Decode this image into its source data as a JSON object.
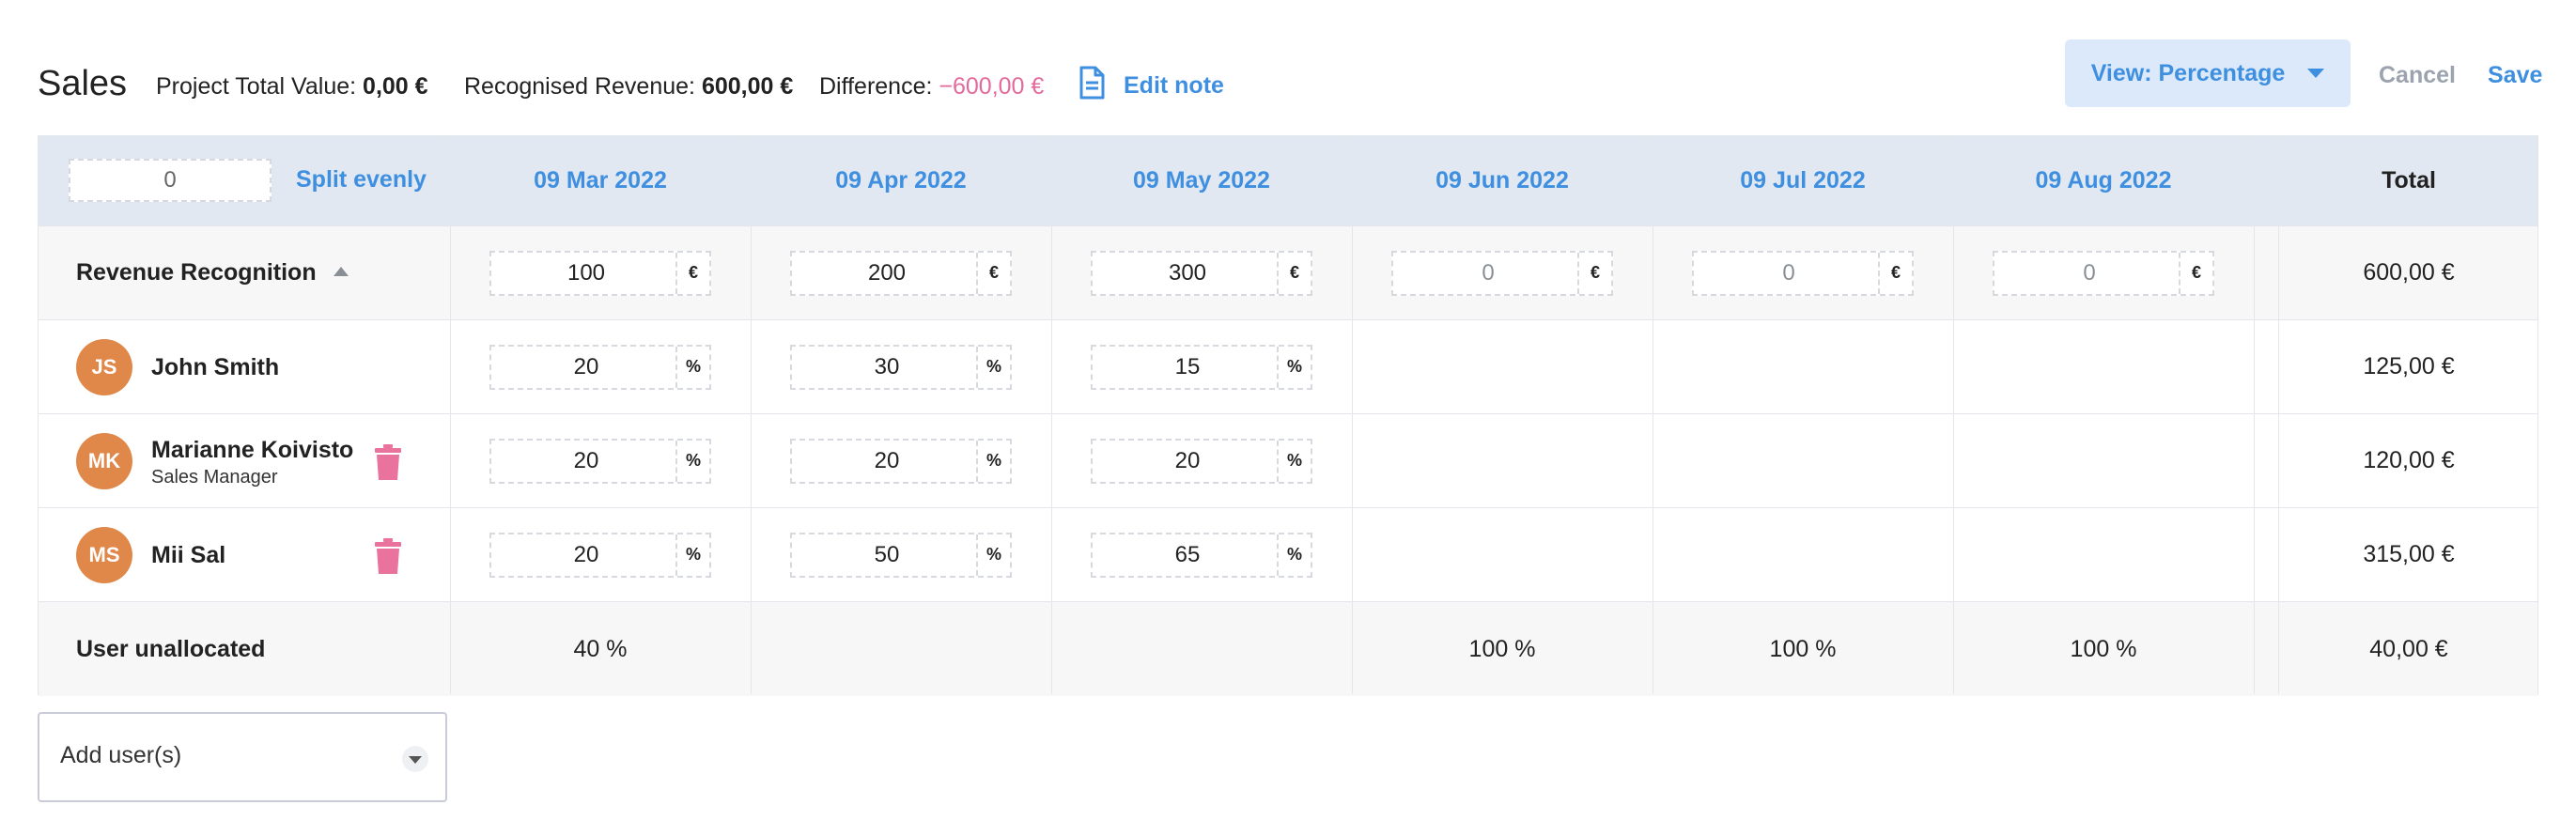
{
  "header": {
    "title": "Sales",
    "project_total_label": "Project Total Value:",
    "project_total_value": "0,00 €",
    "recognised_label": "Recognised Revenue:",
    "recognised_value": "600,00 €",
    "difference_label": "Difference:",
    "difference_value": "−600,00 €",
    "edit_note": "Edit note",
    "view_button": "View: Percentage",
    "cancel": "Cancel",
    "save": "Save"
  },
  "toolbar": {
    "split_input_value": "0",
    "split_evenly": "Split evenly"
  },
  "columns": [
    "09 Mar 2022",
    "09 Apr 2022",
    "09 May 2022",
    "09 Jun 2022",
    "09 Jul 2022",
    "09 Aug 2022"
  ],
  "total_header": "Total",
  "revenue_row": {
    "label": "Revenue Recognition",
    "values": [
      "100",
      "200",
      "300",
      "0",
      "0",
      "0"
    ],
    "suffix": "€",
    "total": "600,00 €"
  },
  "users": [
    {
      "initials": "JS",
      "name": "John Smith",
      "role": "",
      "values": [
        "20",
        "30",
        "15"
      ],
      "suffix": "%",
      "total": "125,00 €"
    },
    {
      "initials": "MK",
      "name": "Marianne Koivisto",
      "role": "Sales Manager",
      "values": [
        "20",
        "20",
        "20"
      ],
      "suffix": "%",
      "total": "120,00 €"
    },
    {
      "initials": "MS",
      "name": "Mii Sal",
      "role": "",
      "values": [
        "20",
        "50",
        "65"
      ],
      "suffix": "%",
      "total": "315,00 €"
    }
  ],
  "unallocated_row": {
    "label": "User unallocated",
    "values": [
      "40 %",
      "",
      "",
      "100 %",
      "100 %",
      "100 %"
    ],
    "total": "40,00 €"
  },
  "add_users": {
    "placeholder": "Add user(s)"
  },
  "colors": {
    "accent": "#3f8fe0",
    "negative": "#e36a9a",
    "avatar": "#e0884a",
    "trash": "#e9739d",
    "header_bg": "#e1e8f1"
  }
}
